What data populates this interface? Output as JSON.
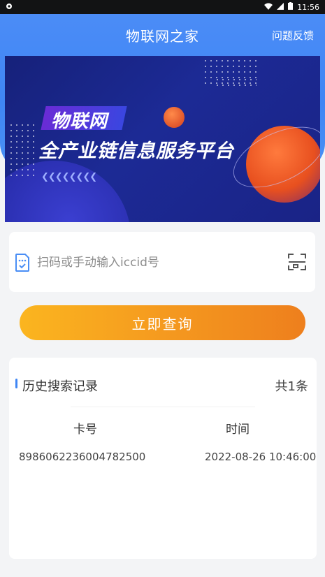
{
  "status_bar": {
    "time": "11:56"
  },
  "header": {
    "title": "物联网之家",
    "feedback": "问题反馈"
  },
  "banner": {
    "tag": "物联网",
    "slogan": "全产业链信息服务平台",
    "chevrons": "❮❮❮❮❮❮❮❮"
  },
  "search": {
    "placeholder": "扫码或手动输入iccid号",
    "value": ""
  },
  "query_button": {
    "label": "立即查询"
  },
  "history": {
    "title": "历史搜索记录",
    "count": "共1条",
    "columns": [
      "卡号",
      "时间"
    ],
    "rows": [
      {
        "card": "8986062236004782500",
        "time": "2022-08-26 10:46:00"
      }
    ]
  },
  "colors": {
    "primary": "#3f86f4",
    "button_start": "#fbb51f",
    "button_end": "#ee7f1d",
    "banner_bg": "#1c2a95"
  }
}
